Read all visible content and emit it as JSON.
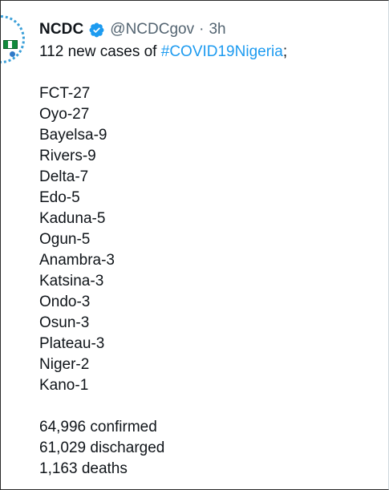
{
  "tweet": {
    "author_name": "NCDC",
    "author_handle": "@NCDCgov",
    "separator": "·",
    "time": "3h",
    "intro_text": "112 new cases of ",
    "hashtag": "#COVID19Nigeria",
    "intro_suffix": ";",
    "cases": [
      "FCT-27",
      "Oyo-27",
      "Bayelsa-9",
      "Rivers-9",
      "Delta-7",
      "Edo-5",
      "Kaduna-5",
      "Ogun-5",
      "Anambra-3",
      "Katsina-3",
      "Ondo-3",
      "Osun-3",
      "Plateau-3",
      "Niger-2",
      "Kano-1"
    ],
    "totals": [
      "64,996 confirmed",
      "61,029 discharged",
      "1,163 deaths"
    ]
  },
  "icons": {
    "avatar": "ncdc-logo-avatar",
    "verified": "verified-badge-icon"
  },
  "colors": {
    "link": "#1d9bf0",
    "text": "#0f1419",
    "muted": "#536471"
  }
}
